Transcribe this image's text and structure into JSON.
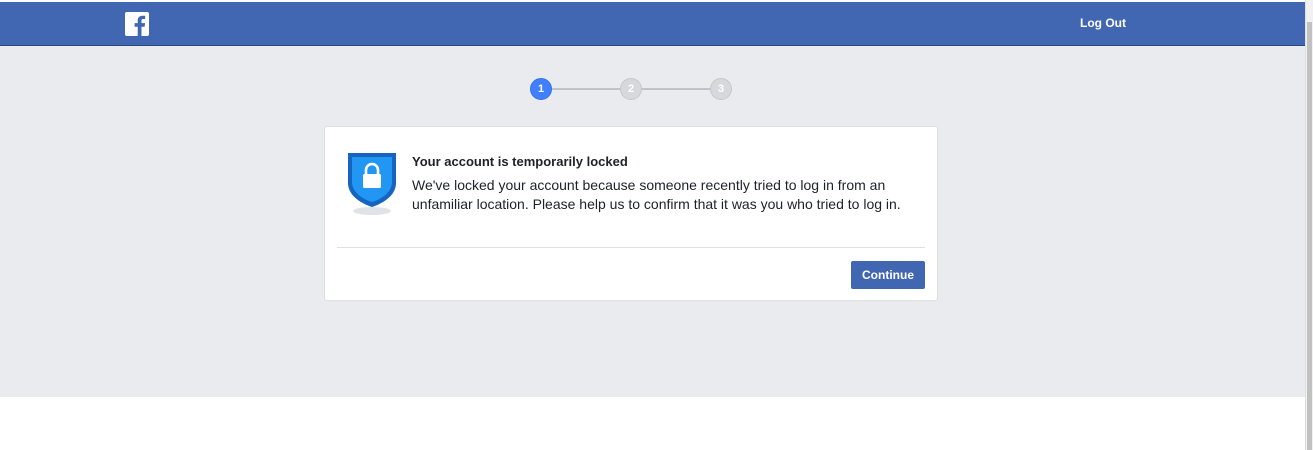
{
  "header": {
    "logo_icon": "facebook-f-icon",
    "logout_label": "Log Out",
    "bar_color": "#4267b2"
  },
  "stepper": {
    "steps": [
      {
        "label": "1",
        "state": "active"
      },
      {
        "label": "2",
        "state": "inactive"
      },
      {
        "label": "3",
        "state": "inactive"
      }
    ]
  },
  "card": {
    "icon": "shield-lock-icon",
    "title": "Your account is temporarily locked",
    "body": "We've locked your account because someone recently tried to log in from an unfamiliar location. Please help us to confirm that it was you who tried to log in.",
    "continue_label": "Continue"
  }
}
